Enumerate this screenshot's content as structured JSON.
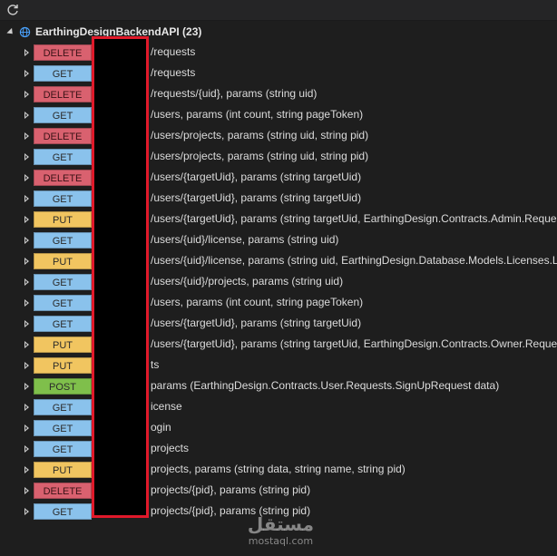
{
  "toolbar": {
    "refresh_icon": "refresh-icon"
  },
  "root": {
    "label": "EarthingDesignBackendAPI (23)",
    "icon": "globe-icon"
  },
  "endpoints": [
    {
      "method": "DELETE",
      "path": "/requests"
    },
    {
      "method": "GET",
      "path": "/requests"
    },
    {
      "method": "DELETE",
      "path": "/requests/{uid}, params (string uid)"
    },
    {
      "method": "GET",
      "path": "/users, params (int count, string pageToken)"
    },
    {
      "method": "DELETE",
      "path": "/users/projects, params (string uid, string pid)"
    },
    {
      "method": "GET",
      "path": "/users/projects, params (string uid, string pid)"
    },
    {
      "method": "DELETE",
      "path": "/users/{targetUid}, params (string targetUid)"
    },
    {
      "method": "GET",
      "path": "/users/{targetUid}, params (string targetUid)"
    },
    {
      "method": "PUT",
      "path": "/users/{targetUid}, params (string targetUid, EarthingDesign.Contracts.Admin.Request"
    },
    {
      "method": "GET",
      "path": "/users/{uid}/license, params (string uid)"
    },
    {
      "method": "PUT",
      "path": "/users/{uid}/license, params (string uid, EarthingDesign.Database.Models.Licenses.Lic"
    },
    {
      "method": "GET",
      "path": "/users/{uid}/projects, params (string uid)"
    },
    {
      "method": "GET",
      "path": "/users, params (int count, string pageToken)"
    },
    {
      "method": "GET",
      "path": "/users/{targetUid}, params (string targetUid)"
    },
    {
      "method": "PUT",
      "path": "/users/{targetUid}, params (string targetUid, EarthingDesign.Contracts.Owner.Request"
    },
    {
      "method": "PUT",
      "path": "ts"
    },
    {
      "method": "POST",
      "path": "params (EarthingDesign.Contracts.User.Requests.SignUpRequest data)"
    },
    {
      "method": "GET",
      "path": "icense"
    },
    {
      "method": "GET",
      "path": "ogin"
    },
    {
      "method": "GET",
      "path": "projects"
    },
    {
      "method": "PUT",
      "path": "projects, params (string data, string name, string pid)"
    },
    {
      "method": "DELETE",
      "path": "projects/{pid}, params (string pid)"
    },
    {
      "method": "GET",
      "path": "projects/{pid}, params (string pid)"
    }
  ],
  "watermark": {
    "logo": "مستقل",
    "url": "mostaql.com"
  },
  "colors": {
    "GET": "#8ac2ec",
    "DELETE": "#d9616f",
    "PUT": "#f1c560",
    "POST": "#7fbf4b",
    "redaction_border": "#e0192a"
  }
}
